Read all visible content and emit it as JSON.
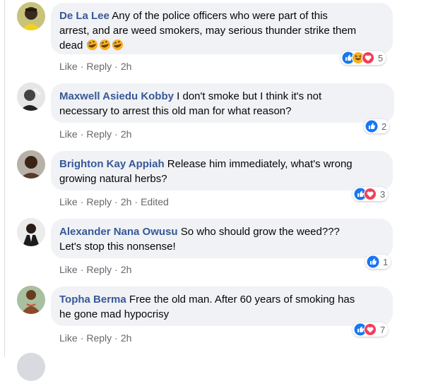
{
  "colors": {
    "name": "#385898",
    "meta": "#65676b",
    "bubble": "#f0f2f5",
    "like": "#1877f2",
    "love": "#f33e58",
    "haha": "#f7b125"
  },
  "comments": [
    {
      "author": "De La Lee",
      "lines": [
        "Any of the police officers who were part of this",
        "arrest, and are weed smokers, may serious thunder strike them",
        "dead"
      ],
      "emojis": [
        "rofl-emoji",
        "rofl-emoji",
        "rofl-emoji"
      ],
      "actions": {
        "like": "Like",
        "reply": "Reply",
        "time": "2h"
      },
      "reactions": [
        "like",
        "haha",
        "love"
      ],
      "reaction_count": "5"
    },
    {
      "author": "Maxwell Asiedu Kobby",
      "lines": [
        "I don't smoke but I think it's not",
        "necessary to arrest this old man for what reason?"
      ],
      "actions": {
        "like": "Like",
        "reply": "Reply",
        "time": "2h"
      },
      "reactions": [
        "like"
      ],
      "reaction_count": "2"
    },
    {
      "author": "Brighton Kay Appiah",
      "lines": [
        "Release him immediately, what's wrong",
        "growing natural herbs?"
      ],
      "actions": {
        "like": "Like",
        "reply": "Reply",
        "time": "2h",
        "edited": "Edited"
      },
      "reactions": [
        "like",
        "love"
      ],
      "reaction_count": "3"
    },
    {
      "author": "Alexander Nana Owusu",
      "lines": [
        "So who should grow the weed???",
        "Let's stop this nonsense!"
      ],
      "actions": {
        "like": "Like",
        "reply": "Reply",
        "time": "2h"
      },
      "reactions": [
        "like"
      ],
      "reaction_count": "1"
    },
    {
      "author": "Topha Berma",
      "lines": [
        "Free the old man. After 60 years of smoking has",
        "he gone mad hypocrisy"
      ],
      "actions": {
        "like": "Like",
        "reply": "Reply",
        "time": "2h"
      },
      "reactions": [
        "like",
        "love"
      ],
      "reaction_count": "7"
    }
  ]
}
